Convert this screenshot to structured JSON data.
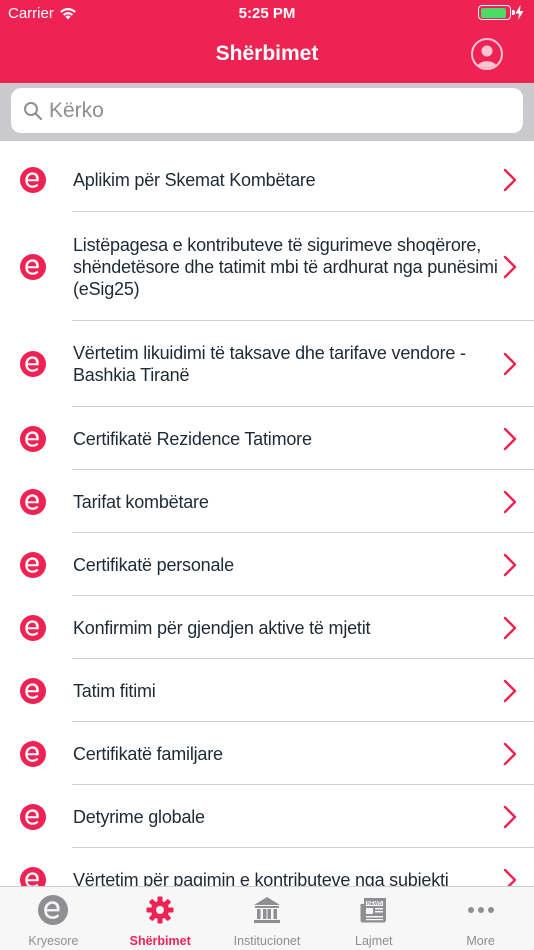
{
  "status": {
    "carrier": "Carrier",
    "time": "5:25 PM",
    "battery_level": 0.92
  },
  "header": {
    "title": "Shërbimet"
  },
  "search": {
    "placeholder": "Kërko"
  },
  "colors": {
    "brand": "#ee2354",
    "text": "#1e2a36",
    "inactive": "#8e8e93",
    "battery": "#4cd964"
  },
  "services": [
    {
      "label": "Aplikim për Skemat Kombëtare"
    },
    {
      "label": "Listëpagesa e kontributeve të sigurimeve shoqërore, shëndetësore dhe tatimit mbi të ardhurat nga punësimi (eSig25)"
    },
    {
      "label": "Vërtetim likuidimi të taksave dhe tarifave vendore - Bashkia Tiranë"
    },
    {
      "label": "Certifikatë Rezidence Tatimore"
    },
    {
      "label": "Tarifat kombëtare"
    },
    {
      "label": "Certifikatë personale"
    },
    {
      "label": "Konfirmim për gjendjen aktive të mjetit"
    },
    {
      "label": "Tatim fitimi"
    },
    {
      "label": "Certifikatë familjare"
    },
    {
      "label": "Detyrime globale"
    },
    {
      "label": "Vërtetim për pagimin e kontributeve nga subjekti"
    }
  ],
  "tabs": [
    {
      "label": "Kryesore",
      "icon": "e-logo-icon",
      "active": false
    },
    {
      "label": "Shërbimet",
      "icon": "gear-icon",
      "active": true
    },
    {
      "label": "Institucionet",
      "icon": "institution-icon",
      "active": false
    },
    {
      "label": "Lajmet",
      "icon": "newspaper-icon",
      "active": false
    },
    {
      "label": "More",
      "icon": "more-dots-icon",
      "active": false
    }
  ]
}
